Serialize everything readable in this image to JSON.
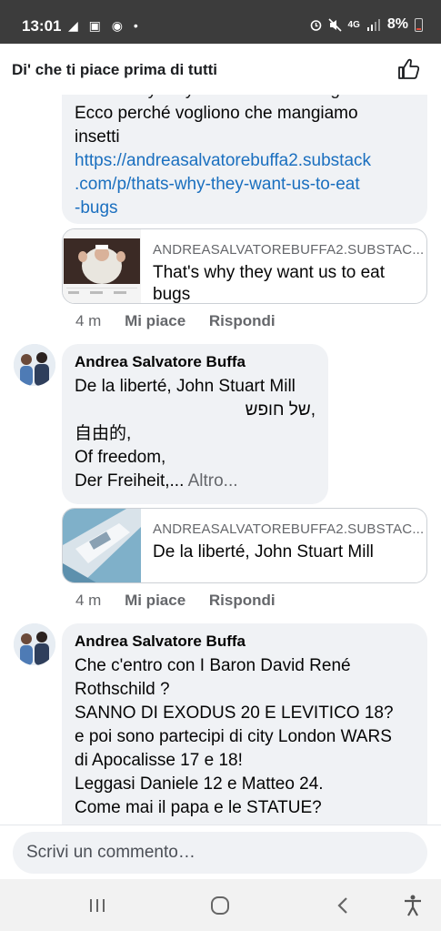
{
  "status_bar": {
    "time": "13:01",
    "left_icons": "◢ ▣ ◉ •",
    "battery": "8%",
    "network": "4G"
  },
  "header": {
    "text": "Di' che ti piace prima di tutti",
    "like_icon": "thumbs-up-outline"
  },
  "comment1": {
    "partial_top_text": "That's why they want us to eat bugs",
    "text_lines": [
      "Ecco perché vogliono che mangiamo",
      "insetti"
    ],
    "link_lines": [
      "https://andreasalvatorebuffa2.substack",
      ".com/p/thats-why-they-want-us-to-eat",
      "-bugs"
    ],
    "card": {
      "domain": "ANDREASALVATOREBUFFA2.SUBSTAC...",
      "title": "That's why they want us to eat bugs"
    },
    "actions": {
      "time": "4 m",
      "like": "Mi piace",
      "reply": "Rispondi"
    }
  },
  "comment2": {
    "author": "Andrea Salvatore Buffa",
    "lines": [
      "De la liberté, John Stuart Mill",
      "של חופש,",
      "自由的,",
      "Of freedom,",
      "Der Freiheit,..."
    ],
    "more": "Altro...",
    "card": {
      "domain": "ANDREASALVATOREBUFFA2.SUBSTAC...",
      "title": "De la liberté, John Stuart Mill"
    },
    "actions": {
      "time": "4 m",
      "like": "Mi piace",
      "reply": "Rispondi"
    }
  },
  "comment3": {
    "author": "Andrea Salvatore Buffa",
    "lines": [
      "Che c'entro con I Baron David René",
      "Rothschild ?",
      "SANNO DI EXODUS 20 E LEVITICO 18?",
      "e poi sono partecipi di city London WARS",
      "di Apocalisse 17 e 18!",
      "Leggasi Daniele 12 e Matteo 24.",
      "Come mai il papa e le STATUE?"
    ]
  },
  "composer": {
    "placeholder": "Scrivi un commento…"
  },
  "nav": {
    "recent": "recent-apps",
    "home": "home",
    "back": "back",
    "accessibility": "accessibility"
  }
}
